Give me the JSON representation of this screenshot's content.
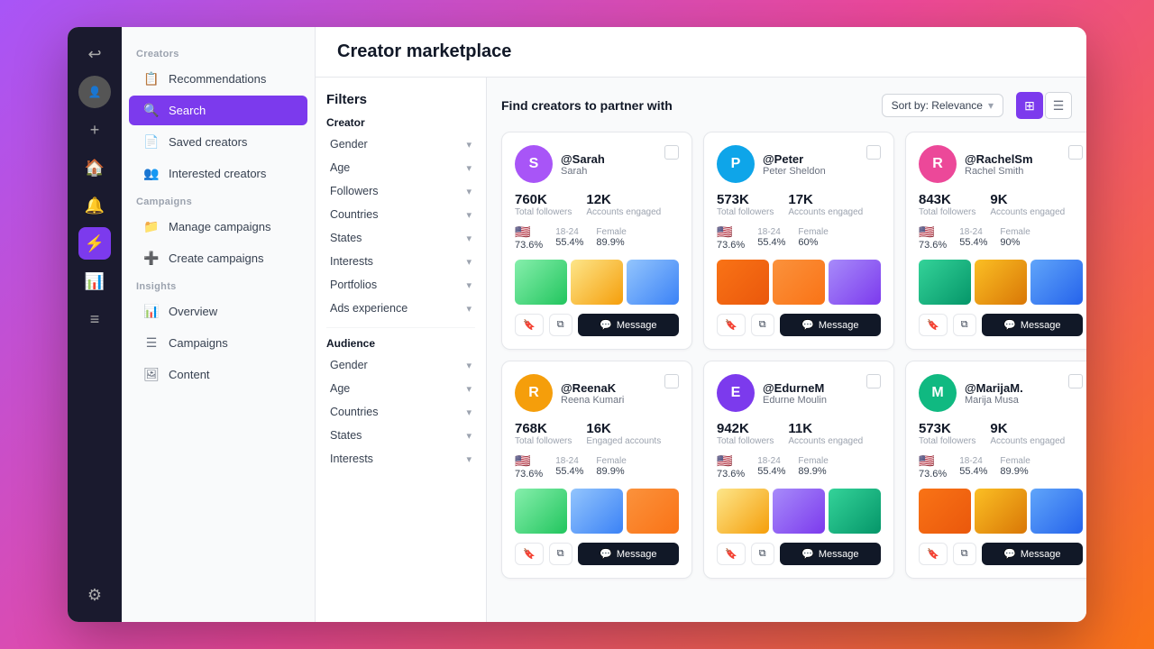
{
  "app": {
    "title": "Creator marketplace",
    "subtitle": "Find creators to partner with"
  },
  "iconBar": {
    "icons": [
      "↩",
      "👤",
      "+",
      "🏠",
      "🔔",
      "⚡",
      "📊",
      "≡"
    ]
  },
  "sidebar": {
    "sections": [
      {
        "label": "Creators",
        "items": [
          {
            "id": "recommendations",
            "label": "Recommendations",
            "icon": "📋",
            "active": false
          },
          {
            "id": "search",
            "label": "Search",
            "icon": "🔍",
            "active": true
          },
          {
            "id": "saved-creators",
            "label": "Saved creators",
            "icon": "📄",
            "active": false
          },
          {
            "id": "interested-creators",
            "label": "Interested creators",
            "icon": "👥",
            "active": false
          }
        ]
      },
      {
        "label": "Campaigns",
        "items": [
          {
            "id": "manage-campaigns",
            "label": "Manage campaigns",
            "icon": "📁",
            "active": false
          },
          {
            "id": "create-campaigns",
            "label": "Create campaigns",
            "icon": "➕",
            "active": false
          }
        ]
      },
      {
        "label": "Insights",
        "items": [
          {
            "id": "overview",
            "label": "Overview",
            "icon": "📊",
            "active": false
          },
          {
            "id": "campaigns-insights",
            "label": "Campaigns",
            "icon": "☰",
            "active": false
          },
          {
            "id": "content",
            "label": "Content",
            "icon": "🖼",
            "active": false
          }
        ]
      }
    ]
  },
  "filters": {
    "title": "Filters",
    "creatorGroup": "Creator",
    "audienceGroup": "Audience",
    "creatorFilters": [
      "Gender",
      "Age",
      "Followers",
      "Countries",
      "States",
      "Interests",
      "Portfolios",
      "Ads experience"
    ],
    "audienceFilters": [
      "Gender",
      "Age",
      "Countries",
      "States",
      "Interests"
    ]
  },
  "sort": {
    "label": "Sort by: Relevance"
  },
  "creators": [
    {
      "handle": "@Sarah",
      "name": "Sarah",
      "totalFollowers": "760K",
      "accountsEngaged": "12K",
      "flagPercentage": "73.6%",
      "ageRange": "18-24",
      "agePercentage": "55.4%",
      "gender": "Female",
      "genderPercentage": "89.9%",
      "images": [
        "img1",
        "img2",
        "img3"
      ],
      "avatarColor": "#a855f7",
      "avatarLetter": "S"
    },
    {
      "handle": "@Peter",
      "name": "Peter Sheldon",
      "totalFollowers": "573K",
      "accountsEngaged": "17K",
      "flagPercentage": "73.6%",
      "ageRange": "18-24",
      "agePercentage": "55.4%",
      "gender": "Female",
      "genderPercentage": "60%",
      "images": [
        "img4",
        "img5",
        "img6"
      ],
      "avatarColor": "#0ea5e9",
      "avatarLetter": "P"
    },
    {
      "handle": "@RachelSm",
      "name": "Rachel Smith",
      "totalFollowers": "843K",
      "accountsEngaged": "9K",
      "flagPercentage": "73.6%",
      "ageRange": "18-24",
      "agePercentage": "55.4%",
      "gender": "Female",
      "genderPercentage": "90%",
      "images": [
        "img7",
        "img8",
        "img9"
      ],
      "avatarColor": "#ec4899",
      "avatarLetter": "R"
    },
    {
      "handle": "@ReenaK",
      "name": "Reena Kumari",
      "totalFollowers": "768K",
      "accountsEngaged": "16K",
      "flagPercentage": "73.6%",
      "ageRange": "18-24",
      "agePercentage": "55.4%",
      "gender": "Female",
      "genderPercentage": "89.9%",
      "images": [
        "img1",
        "img3",
        "img5"
      ],
      "avatarColor": "#f59e0b",
      "avatarLetter": "R"
    },
    {
      "handle": "@EdurneM",
      "name": "Edurne Moulin",
      "totalFollowers": "942K",
      "accountsEngaged": "11K",
      "flagPercentage": "73.6%",
      "ageRange": "18-24",
      "agePercentage": "55.4%",
      "gender": "Female",
      "genderPercentage": "89.9%",
      "images": [
        "img2",
        "img6",
        "img7"
      ],
      "avatarColor": "#7c3aed",
      "avatarLetter": "E"
    },
    {
      "handle": "@MarijaM.",
      "name": "Marija Musa",
      "totalFollowers": "573K",
      "accountsEngaged": "9K",
      "flagPercentage": "73.6%",
      "ageRange": "18-24",
      "agePercentage": "55.4%",
      "gender": "Female",
      "genderPercentage": "89.9%",
      "images": [
        "img4",
        "img8",
        "img9"
      ],
      "avatarColor": "#10b981",
      "avatarLetter": "M"
    }
  ],
  "labels": {
    "totalFollowers": "Total followers",
    "accountsEngaged": "Accounts engaged",
    "engagedAccounts": "Engaged accounts",
    "message": "Message",
    "bookmark": "🔖",
    "copy": "⧉"
  }
}
